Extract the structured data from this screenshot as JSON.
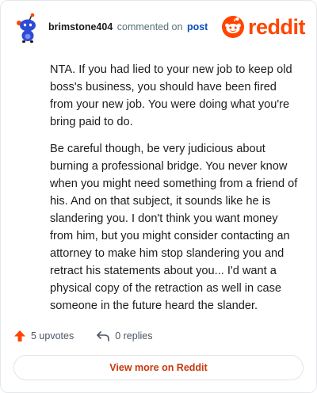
{
  "header": {
    "username": "brimstone404",
    "verb": "commented on",
    "target": "post",
    "logo_text": "reddit",
    "avatar_icon": "snoo-avatar-icon",
    "logo_icon": "reddit-snoo-icon"
  },
  "comment": {
    "paragraphs": [
      "NTA. If you had lied to your new job to keep old boss's business, you should have been fired from your new job. You were doing what you're bring paid to do.",
      "Be careful though, be very judicious about burning a professional bridge. You never know when you might need something from a friend of his. And on that subject, it sounds like he is slandering you. I don't think you want money from him, but you might consider contacting an attorney to make him stop slandering you and retract his statements about you... I'd want a physical copy of the retraction as well in case someone in the future heard the slander."
    ]
  },
  "footer": {
    "upvotes": "5 upvotes",
    "replies": "0 replies",
    "view_more": "View more on Reddit"
  },
  "colors": {
    "brand": "#ff4500",
    "link": "#0a4fbd",
    "button_text": "#c8380a"
  }
}
